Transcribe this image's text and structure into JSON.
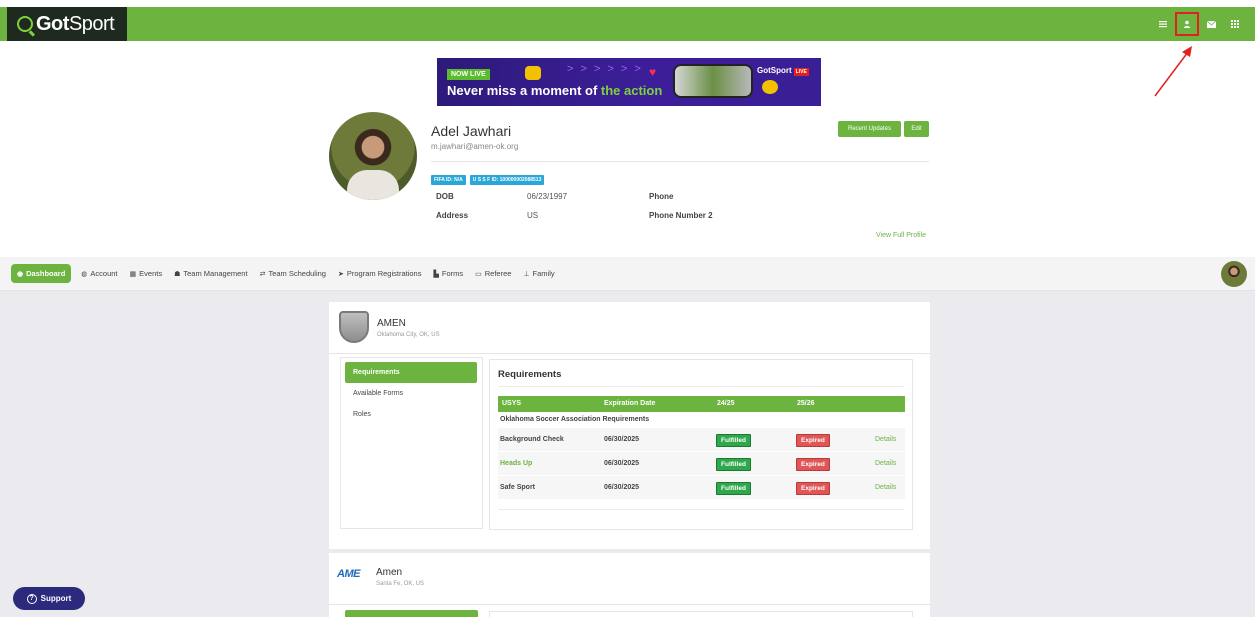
{
  "brand": {
    "logo_name": "Got",
    "logo_suffix": "Sport",
    "accent": "#6cb33f",
    "dark": "#1e2a1f",
    "alert": "#e0211f"
  },
  "top_icons": [
    "list-icon",
    "user-icon",
    "mail-icon",
    "grid-icon"
  ],
  "banner": {
    "badge": "NOW LIVE",
    "headline_a": "Never miss a moment of ",
    "headline_b": "the action",
    "chevrons": "> > > > > >",
    "brand_text": "GotSport",
    "brand_live": "LIVE"
  },
  "profile": {
    "name": "Adel Jawhari",
    "email": "m.jawhari@amen-ok.org",
    "fifa_id": "FIFA ID: N/A",
    "usysp_id": "U S S F ID: 100000002088513",
    "dob_label": "DOB",
    "dob_value": "06/23/1997",
    "address_label": "Address",
    "address_value": "US",
    "phone_label": "Phone",
    "phone2_label": "Phone Number 2",
    "recent_updates": "Recent Updates",
    "edit": "Edit",
    "view_full_profile": "View Full Profile"
  },
  "nav": {
    "items": [
      {
        "label": "Dashboard",
        "icon": "dashboard-icon"
      },
      {
        "label": "Account",
        "icon": "account-icon"
      },
      {
        "label": "Events",
        "icon": "calendar-icon"
      },
      {
        "label": "Team Management",
        "icon": "users-icon"
      },
      {
        "label": "Team Scheduling",
        "icon": "swap-icon"
      },
      {
        "label": "Program Registrations",
        "icon": "send-icon"
      },
      {
        "label": "Forms",
        "icon": "file-icon"
      },
      {
        "label": "Referee",
        "icon": "calendar-icon"
      },
      {
        "label": "Family",
        "icon": "sitemap-icon"
      }
    ]
  },
  "org1": {
    "name": "AMEN",
    "location": "Oklahoma City, OK, US"
  },
  "side_menu": {
    "requirements": "Requirements",
    "available_forms": "Available Forms",
    "roles": "Roles"
  },
  "requirements": {
    "title": "Requirements",
    "columns": [
      "USYS",
      "Expiration Date",
      "24/25",
      "25/26"
    ],
    "section": "Oklahoma Soccer Association Requirements",
    "rows": [
      {
        "name": "Background Check",
        "date": "06/30/2025",
        "s1": "Fulfilled",
        "s2": "Expired",
        "link": "Details"
      },
      {
        "name": "Heads Up",
        "date": "06/30/2025",
        "s1": "Fulfilled",
        "s2": "Expired",
        "link": "Details"
      },
      {
        "name": "Safe Sport",
        "date": "06/30/2025",
        "s1": "Fulfilled",
        "s2": "Expired",
        "link": "Details"
      }
    ]
  },
  "org2": {
    "logo": "AME",
    "name": "Amen",
    "location": "Santa Fe, OK, US"
  },
  "support": {
    "label": "Support"
  }
}
